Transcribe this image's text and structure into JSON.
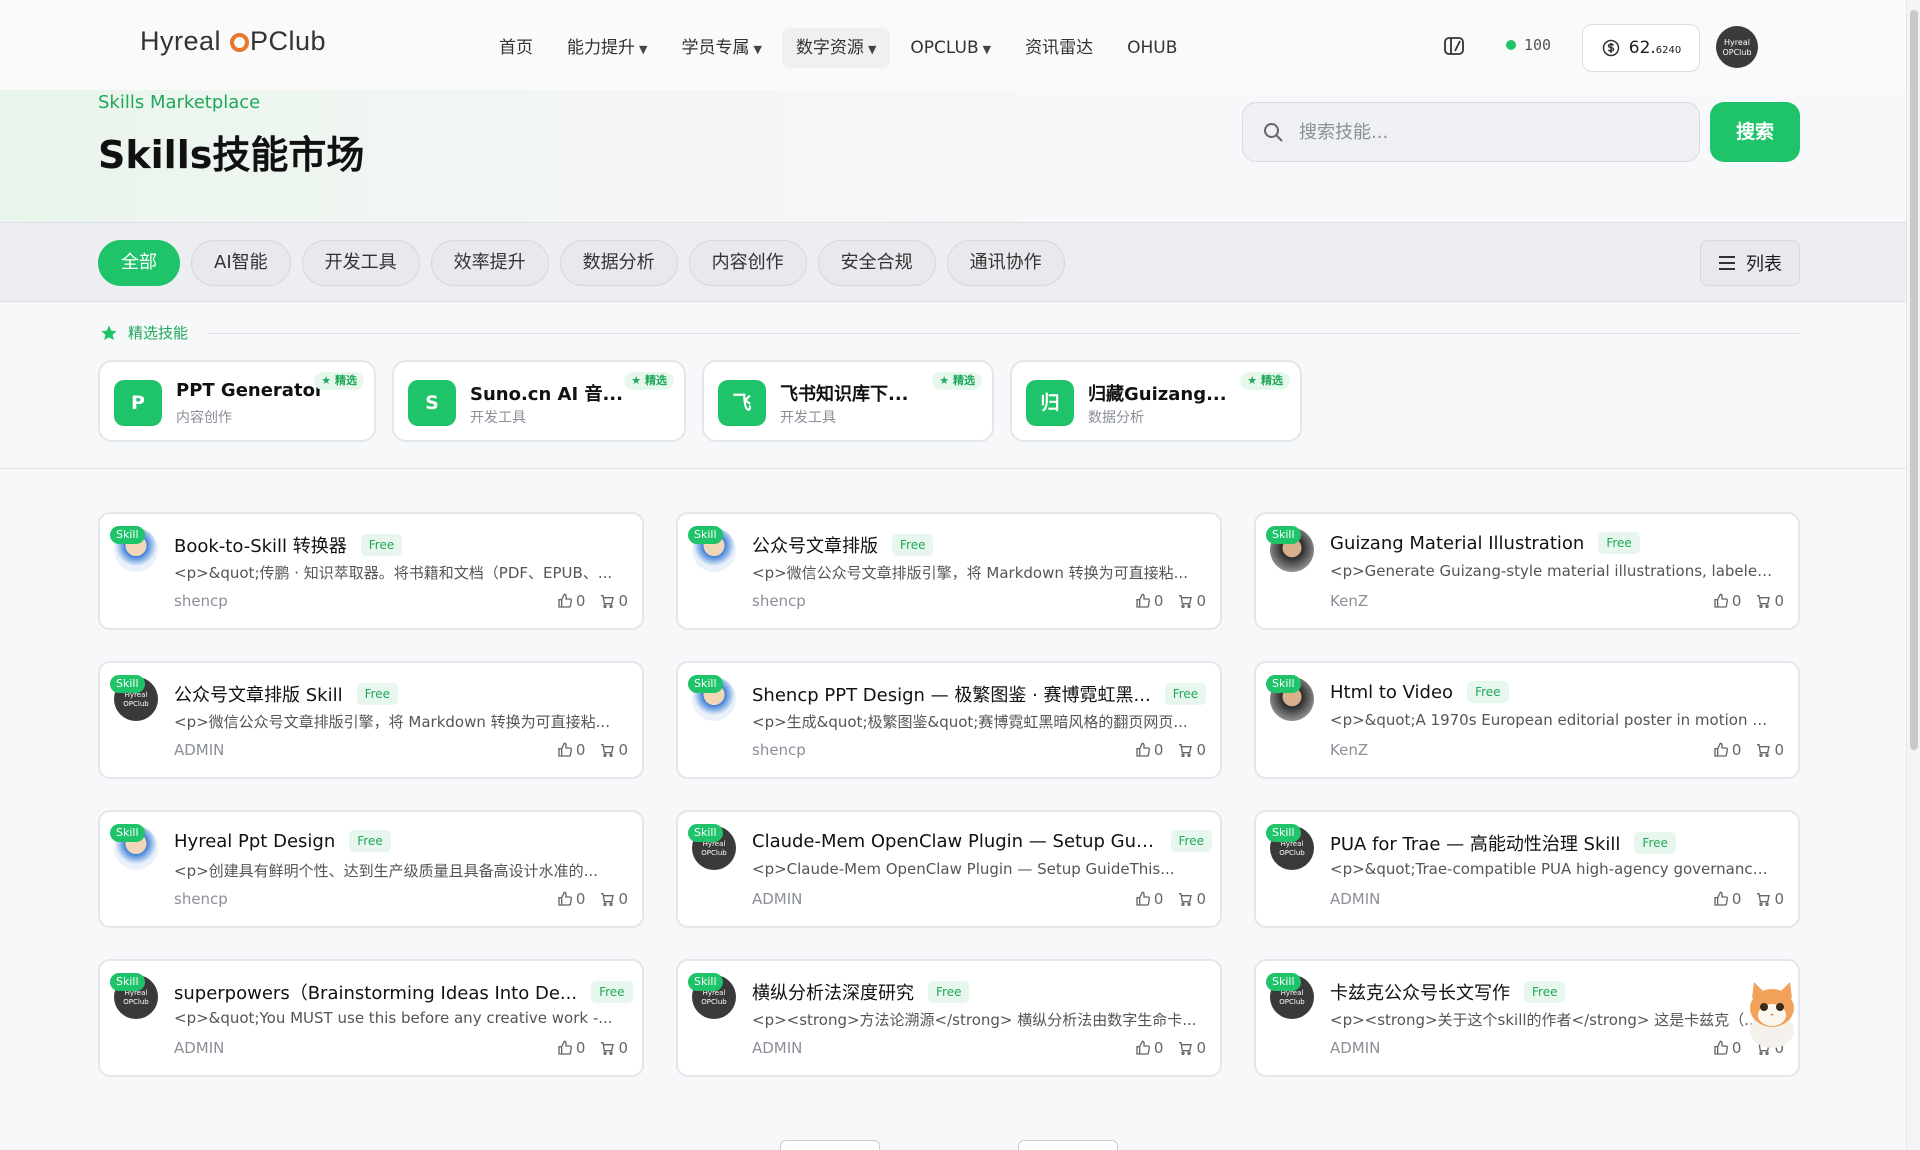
{
  "header": {
    "logo": "Hyreal OPClub",
    "nav": [
      {
        "label": "首页",
        "dropdown": false
      },
      {
        "label": "能力提升",
        "dropdown": true
      },
      {
        "label": "学员专属",
        "dropdown": true
      },
      {
        "label": "数字资源",
        "dropdown": true,
        "active": true
      },
      {
        "label": "OPCLUB",
        "dropdown": true
      },
      {
        "label": "资讯雷达",
        "dropdown": false
      },
      {
        "label": "OHUB",
        "dropdown": false
      }
    ],
    "points": "100",
    "balance_main": "62.",
    "balance_sub": "6240",
    "avatar_text": "Hyreal OPClub"
  },
  "hero": {
    "eyebrow": "Skills Marketplace",
    "title": "Skills技能市场",
    "search_placeholder": "搜索技能...",
    "search_button": "搜索"
  },
  "filters": {
    "chips": [
      "全部",
      "AI智能",
      "开发工具",
      "效率提升",
      "数据分析",
      "内容创作",
      "安全合规",
      "通讯协作"
    ],
    "active": 0,
    "view_label": "列表"
  },
  "featured": {
    "label": "精选技能",
    "badge": "★ 精选",
    "items": [
      {
        "icon": "P",
        "name": "PPT Generator",
        "category": "内容创作"
      },
      {
        "icon": "S",
        "name": "Suno.cn AI 音...",
        "category": "开发工具"
      },
      {
        "icon": "飞",
        "name": "飞书知识库下...",
        "category": "开发工具"
      },
      {
        "icon": "归",
        "name": "归藏Guizang...",
        "category": "数据分析"
      }
    ]
  },
  "skills": {
    "tag": "Skill",
    "free_label": "Free",
    "items": [
      {
        "title": "Book-to-Skill 转换器",
        "desc": "<p>&quot;传鹏 · 知识萃取器。将书籍和文档（PDF、EPUB、...",
        "author": "shencp",
        "likes": "0",
        "carts": "0",
        "avatar": "a1"
      },
      {
        "title": "公众号文章排版",
        "desc": "<p>微信公众号文章排版引擎，将 Markdown 转换为可直接粘...",
        "author": "shencp",
        "likes": "0",
        "carts": "0",
        "avatar": "a1"
      },
      {
        "title": "Guizang Material Illustration",
        "desc": "<p>Generate Guizang-style material illustrations, labeled...",
        "author": "KenZ",
        "likes": "0",
        "carts": "0",
        "avatar": "a3"
      },
      {
        "title": "公众号文章排版 Skill",
        "desc": "<p>微信公众号文章排版引擎，将 Markdown 转换为可直接粘...",
        "author": "ADMIN",
        "likes": "0",
        "carts": "0",
        "avatar": "a2"
      },
      {
        "title": "Shencp PPT Design — 极繁图鉴 · 赛博霓虹黑...",
        "desc": "<p>生成&quot;极繁图鉴&quot;赛博霓虹黑暗风格的翻页网页...",
        "author": "shencp",
        "likes": "0",
        "carts": "0",
        "avatar": "a1"
      },
      {
        "title": "Html to Video",
        "desc": "<p>&quot;A 1970s European editorial poster in motion — ...",
        "author": "KenZ",
        "likes": "0",
        "carts": "0",
        "avatar": "a3"
      },
      {
        "title": "Hyreal Ppt Design",
        "desc": "<p>创建具有鲜明个性、达到生产级质量且具备高设计水准的...",
        "author": "shencp",
        "likes": "0",
        "carts": "0",
        "avatar": "a1"
      },
      {
        "title": "Claude-Mem OpenClaw Plugin — Setup Gui...",
        "desc": "<p>Claude-Mem OpenClaw Plugin — Setup GuideThis...",
        "author": "ADMIN",
        "likes": "0",
        "carts": "0",
        "avatar": "a2"
      },
      {
        "title": "PUA for Trae — 高能动性治理 Skill",
        "desc": "<p>&quot;Trae-compatible PUA high-agency governance...",
        "author": "ADMIN",
        "likes": "0",
        "carts": "0",
        "avatar": "a2"
      },
      {
        "title": "superpowers（Brainstorming Ideas Into De...",
        "desc": "<p>&quot;You MUST use this before any creative work -...",
        "author": "ADMIN",
        "likes": "0",
        "carts": "0",
        "avatar": "a2"
      },
      {
        "title": "横纵分析法深度研究",
        "desc": "<p><strong>方法论溯源</strong> 横纵分析法由数字生命卡...",
        "author": "ADMIN",
        "likes": "0",
        "carts": "0",
        "avatar": "a2"
      },
      {
        "title": "卡兹克公众号长文写作",
        "desc": "<p><strong>关于这个skill的作者</strong> 这是卡兹克（...",
        "author": "ADMIN",
        "likes": "0",
        "carts": "0",
        "avatar": "a2"
      }
    ]
  },
  "colors": {
    "accent": "#1fc36a",
    "accent_text": "#1fa85a"
  }
}
